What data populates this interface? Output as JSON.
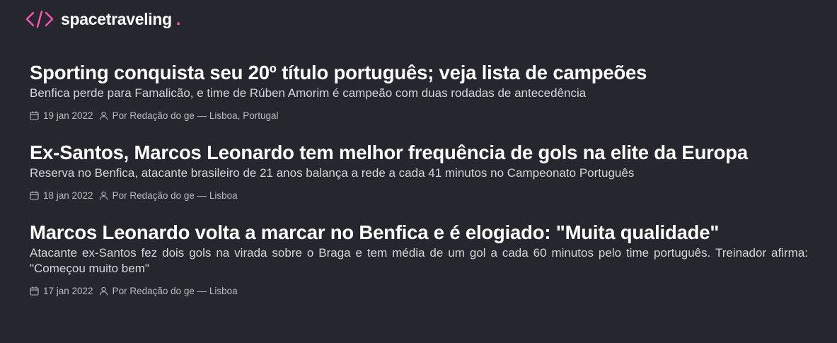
{
  "brand": {
    "name": "spacetraveling",
    "dot": ".",
    "icon": "code-brackets-icon",
    "accent_color": "#ff57b2"
  },
  "posts": [
    {
      "title": "Sporting conquista seu 20º título português; veja lista de campeões",
      "subtitle": "Benfica perde para Famalicão, e time de Rúben Amorim é campeão com duas rodadas de antecedência",
      "date": "19 jan 2022",
      "author": "Por Redação do ge — Lisboa, Portugal"
    },
    {
      "title": "Ex-Santos, Marcos Leonardo tem melhor frequência de gols na elite da Europa",
      "subtitle": "Reserva no Benfica, atacante brasileiro de 21 anos balança a rede a cada 41 minutos no Campeonato Português",
      "date": "18 jan 2022",
      "author": "Por Redação do ge — Lisboa"
    },
    {
      "title": "Marcos Leonardo volta a marcar no Benfica e é elogiado: \"Muita qualidade\"",
      "subtitle": "Atacante ex-Santos fez dois gols na virada sobre o Braga e tem média de um gol a cada 60 minutos pelo time português. Treinador afirma: \"Começou muito bem\"",
      "date": "17 jan 2022",
      "author": "Por Redação do ge — Lisboa"
    }
  ]
}
